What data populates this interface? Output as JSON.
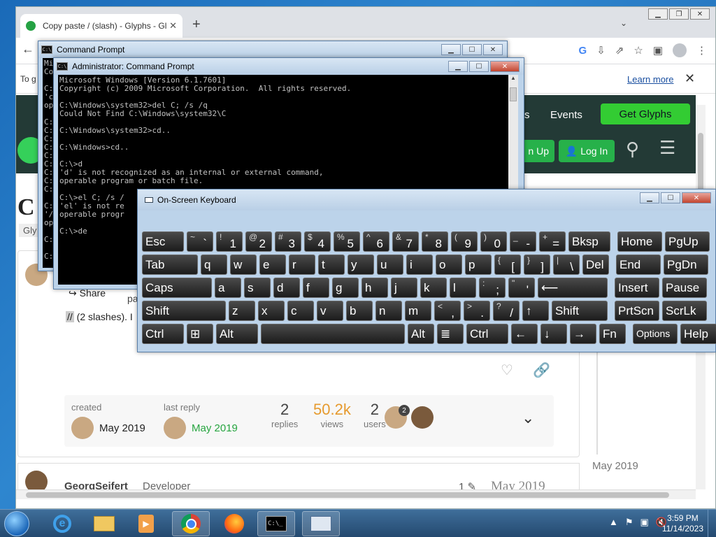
{
  "browser": {
    "tab_title": "Copy paste / (slash) - Glyphs - Gl",
    "tab_close": "✕",
    "new_tab": "+",
    "tab_search": "⌄",
    "back": "←",
    "infobar_lead": "To g",
    "learn_more": "Learn more",
    "infobar_close": "✕",
    "toolbar_g": "G"
  },
  "site": {
    "nav_partial": "rs",
    "nav_events": "Events",
    "get_glyphs": "Get Glyphs",
    "signup_partial": "n Up",
    "login": "Log In",
    "title_partial": "C",
    "category_partial": "Gly",
    "share": "Share",
    "frag_pa": "pa",
    "post_code": "//",
    "post_text": " (2 slashes). I",
    "topic_map": {
      "created_label": "created",
      "created_date": "May 2019",
      "last_reply_label": "last reply",
      "last_reply_date": "May 2019",
      "replies": "2",
      "replies_label": "replies",
      "views": "50.2k",
      "views_label": "views",
      "users": "2",
      "users_label": "users",
      "avatar_count": "2"
    },
    "timeline_date": "May 2019",
    "reply": {
      "name": "GeorgSeifert",
      "role": "Developer",
      "edits": "1",
      "date": "May 2019"
    }
  },
  "cmd_back": {
    "title": "Command Prompt",
    "lines": [
      "Mi",
      "Co",
      "",
      "C:",
      "'c",
      "op",
      "",
      "C:",
      "C:",
      "C:",
      "C:",
      "C:",
      "C:",
      "C:",
      "C:",
      "C:",
      "",
      "C:",
      "'/",
      "op",
      "",
      "C:",
      "",
      "C:"
    ]
  },
  "cmd_front": {
    "title": "Administrator:  Command Prompt",
    "text": "Microsoft Windows [Version 6.1.7601]\nCopyright (c) 2009 Microsoft Corporation.  All rights reserved.\n\nC:\\Windows\\system32>del C; /s /q\nCould Not Find C:\\Windows\\system32\\C\n\nC:\\Windows\\system32>cd..\n\nC:\\Windows>cd..\n\nC:\\>d\n'd' is not recognized as an internal or external command,\noperable program or batch file.\n\nC:\\>el C; /s /\n'el' is not re\noperable progr\n\nC:\\>de"
  },
  "osk": {
    "title": "On-Screen Keyboard",
    "rows": [
      [
        {
          "t": "Esc",
          "w": "w2"
        },
        {
          "s": "~",
          "m": "`"
        },
        {
          "s": "!",
          "m": "1"
        },
        {
          "s": "@",
          "m": "2"
        },
        {
          "s": "#",
          "m": "3"
        },
        {
          "s": "$",
          "m": "4"
        },
        {
          "s": "%",
          "m": "5"
        },
        {
          "s": "^",
          "m": "6"
        },
        {
          "s": "&",
          "m": "7"
        },
        {
          "s": "*",
          "m": "8"
        },
        {
          "s": "(",
          "m": "9"
        },
        {
          "s": ")",
          "m": "0"
        },
        {
          "s": "_",
          "m": "-"
        },
        {
          "s": "+",
          "m": "="
        },
        {
          "t": "Bksp",
          "w": "w2"
        },
        {
          "t": "Home",
          "w": "nav",
          "g": true
        },
        {
          "t": "PgUp",
          "w": "nav"
        }
      ],
      [
        {
          "t": "Tab",
          "w": "w3"
        },
        {
          "t": "q"
        },
        {
          "t": "w"
        },
        {
          "t": "e"
        },
        {
          "t": "r"
        },
        {
          "t": "t"
        },
        {
          "t": "y"
        },
        {
          "t": "u"
        },
        {
          "t": "i"
        },
        {
          "t": "o"
        },
        {
          "t": "p"
        },
        {
          "s": "{",
          "m": "["
        },
        {
          "s": "}",
          "m": "]"
        },
        {
          "s": "|",
          "m": "\\"
        },
        {
          "t": "Del"
        },
        {
          "t": "End",
          "w": "nav",
          "g": true
        },
        {
          "t": "PgDn",
          "w": "nav"
        }
      ],
      [
        {
          "t": "Caps",
          "w": "w4"
        },
        {
          "t": "a"
        },
        {
          "t": "s"
        },
        {
          "t": "d"
        },
        {
          "t": "f"
        },
        {
          "t": "g"
        },
        {
          "t": "h"
        },
        {
          "t": "j"
        },
        {
          "t": "k"
        },
        {
          "t": "l"
        },
        {
          "s": ":",
          "m": ";"
        },
        {
          "s": "\"",
          "m": "'"
        },
        {
          "t": "⟵",
          "w": "w4"
        },
        {
          "t": "Insert",
          "w": "nav",
          "g": true
        },
        {
          "t": "Pause",
          "w": "nav"
        }
      ],
      [
        {
          "t": "Shift",
          "w": "w5"
        },
        {
          "t": "z"
        },
        {
          "t": "x"
        },
        {
          "t": "c"
        },
        {
          "t": "v"
        },
        {
          "t": "b"
        },
        {
          "t": "n"
        },
        {
          "t": "m"
        },
        {
          "s": "<",
          "m": ","
        },
        {
          "s": ">",
          "m": "."
        },
        {
          "s": "?",
          "m": "/"
        },
        {
          "t": "↑"
        },
        {
          "t": "Shift",
          "w": "w3"
        },
        {
          "t": "PrtScn",
          "w": "nav",
          "g": true
        },
        {
          "t": "ScrLk",
          "w": "nav"
        }
      ],
      [
        {
          "t": "Ctrl",
          "w": "w2"
        },
        {
          "t": "⊞"
        },
        {
          "t": "Alt",
          "w": "w2"
        },
        {
          "t": "",
          "w": "sp"
        },
        {
          "t": "Alt"
        },
        {
          "t": "≣"
        },
        {
          "t": "Ctrl",
          "w": "w2"
        },
        {
          "t": "←"
        },
        {
          "t": "↓"
        },
        {
          "t": "→"
        },
        {
          "t": "Fn"
        },
        {
          "t": "Options",
          "w": "nav",
          "g": true,
          "small": true
        },
        {
          "t": "Help",
          "w": "nav"
        }
      ]
    ]
  },
  "taskbar": {
    "clock_time": "3:59 PM",
    "clock_date": "11/14/2023",
    "tray_icons": [
      "▲",
      "⚑",
      "▣",
      "🔇"
    ]
  },
  "colors": {
    "site_header": "#233a36",
    "accent_green": "#33cc33",
    "views_orange": "#e69a2e"
  }
}
